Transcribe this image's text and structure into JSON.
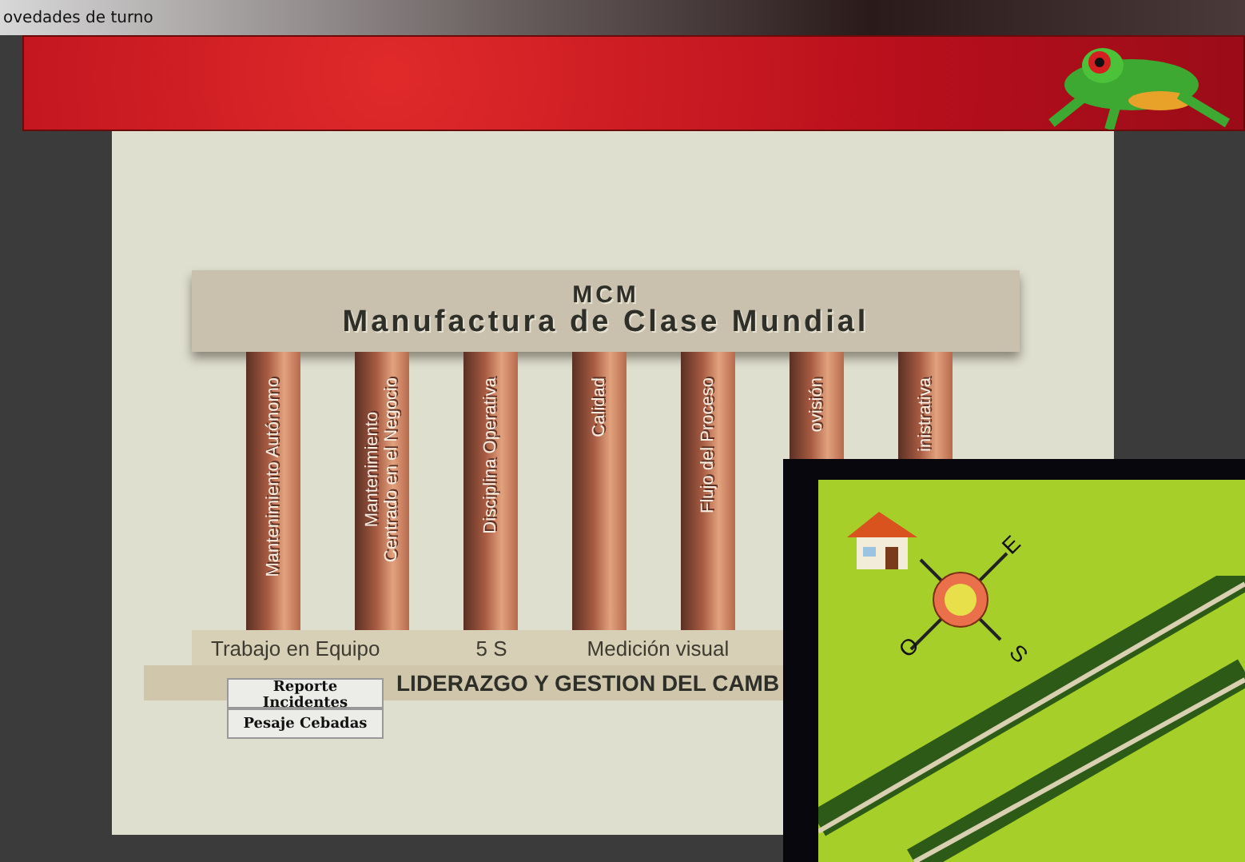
{
  "window": {
    "title": "ovedades de turno"
  },
  "temple": {
    "acronym": "MCM",
    "title": "Manufactura de Clase Mundial",
    "pillars": [
      {
        "label": "Mantenimiento Autónomo"
      },
      {
        "label": "Mantenimiento\nCentrado en el Negocio"
      },
      {
        "label": "Disciplina Operativa"
      },
      {
        "label": "Calidad"
      },
      {
        "label": "Flujo del Proceso"
      },
      {
        "label": "ovisión"
      },
      {
        "label": "inistrativa"
      }
    ],
    "foundations": [
      "Trabajo en Equipo",
      "5 S",
      "Medición visual"
    ],
    "base": "LIDERAZGO Y GESTION DEL CAMB"
  },
  "buttons": [
    "Reporte Incidentes",
    "Pesaje Cebadas"
  ],
  "map": {
    "compass": [
      "E",
      "S",
      "O"
    ]
  }
}
